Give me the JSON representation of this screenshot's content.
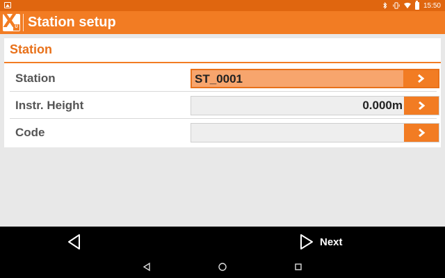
{
  "status_bar": {
    "time": "15:50",
    "icons": [
      "image-icon",
      "bluetooth-icon",
      "vibrate-icon",
      "wifi-icon",
      "battery-icon"
    ]
  },
  "app_bar": {
    "title": "Station setup",
    "logo_icon": "app-logo-icon"
  },
  "section": {
    "title": "Station"
  },
  "rows": [
    {
      "label": "Station",
      "value": "ST_0001",
      "active": true
    },
    {
      "label": "Instr. Height",
      "value": "0.000m",
      "active": false
    },
    {
      "label": "Code",
      "value": "",
      "active": false
    }
  ],
  "bottom_bar": {
    "back_icon": "back-triangle-icon",
    "next_label": "Next"
  },
  "nav_bar": {
    "icons": [
      "nav-back-icon",
      "nav-home-icon",
      "nav-recents-icon"
    ]
  },
  "colors": {
    "status_bar": "#e0660f",
    "app_bar": "#f27c23",
    "accent_text": "#e8711a",
    "active_field": "#f7a56d"
  }
}
